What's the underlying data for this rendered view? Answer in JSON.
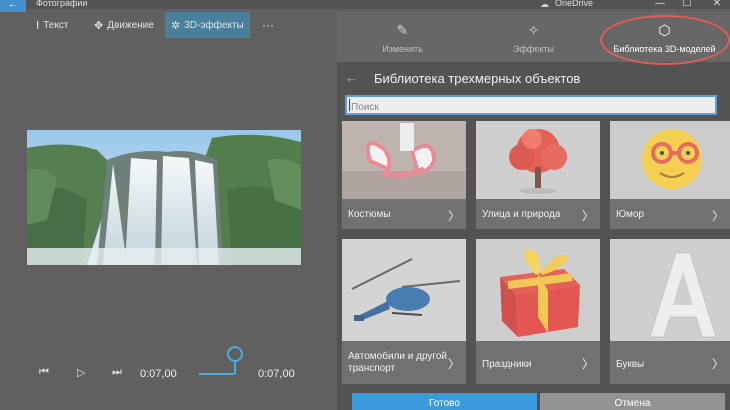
{
  "window": {
    "app_title": "Фотографии",
    "onedrive_label": "OneDrive",
    "back_glyph": "←",
    "minimize_glyph": "—",
    "maximize_glyph": "☐",
    "close_glyph": "✕"
  },
  "toolbar": {
    "items": [
      {
        "label": "Текст",
        "icon": "text-icon",
        "glyph": "Ⅰ"
      },
      {
        "label": "Движение",
        "icon": "motion-icon",
        "glyph": "✥"
      },
      {
        "label": "3D-эффекты",
        "icon": "3d-effects-icon",
        "glyph": "✲"
      }
    ],
    "more_glyph": "···"
  },
  "playback": {
    "prev_glyph": "⏮",
    "play_glyph": "▷",
    "next_glyph": "⏭",
    "current_time": "0:07,00",
    "end_time": "0:07,00"
  },
  "panel": {
    "tabs": [
      {
        "label": "Изменить",
        "icon": "pencil-icon",
        "glyph": "✎"
      },
      {
        "label": "Эффекты",
        "icon": "sparkle-icon",
        "glyph": "✧"
      },
      {
        "label": "Библиотека 3D-моделей",
        "icon": "cube-icon",
        "glyph": "⬡"
      }
    ],
    "active_tab": 2,
    "library_title": "Библиотека трехмерных объектов",
    "back_glyph": "←",
    "search_placeholder": "Поиск",
    "categories": [
      {
        "label": "Костюмы",
        "image": "bunny-ears-headband"
      },
      {
        "label": "Улица и природа",
        "image": "red-tree"
      },
      {
        "label": "Юмор",
        "image": "emoji-with-glasses"
      },
      {
        "label": "Автомобили и другой транспорт",
        "image": "helicopter"
      },
      {
        "label": "Праздники",
        "image": "gift-box"
      },
      {
        "label": "Буквы",
        "image": "letter-a"
      }
    ],
    "chevron_glyph": "〉",
    "ok_label": "Готово",
    "cancel_label": "Отмена"
  },
  "colors": {
    "accent": "#1f8dd6",
    "highlight_circle": "#e0463e",
    "active_tool": "#2f6f8f"
  }
}
